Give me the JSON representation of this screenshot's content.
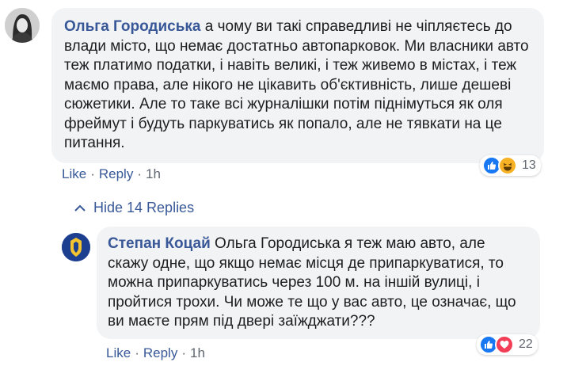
{
  "comment": {
    "author": "Ольга Городиська",
    "text": "а чому ви такі справедливі не чіпляєтесь до влади місто, що немає достатньо автопарковок. Ми власники авто теж платимо податки, і навіть великі, і теж живемо в містах, і теж маємо права, але нікого не цікавить об'єктивність, лише дешеві сюжетики. Але то таке всі журналішки потім піднімуться як оля фреймут і будуть паркуватись як попало, але не тявкати на це питання.",
    "like_label": "Like",
    "reply_label": "Reply",
    "time": "1h",
    "reactions": {
      "icons": [
        "like-icon",
        "haha-icon"
      ],
      "count": "13"
    }
  },
  "hide_replies_label": "Hide 14 Replies",
  "reply": {
    "author": "Степан Коцай",
    "text": "Ольга Городиська я теж маю авто, але скажу одне, що якщо немає місця де припаркуватися, то можна припаркуватись через 100 м. на іншій вулиці, і пройтися трохи. Чи може те що у вас авто, це означає, що ви маєте прям під двері заїжджати???",
    "like_label": "Like",
    "reply_label": "Reply",
    "time": "1h",
    "reactions": {
      "icons": [
        "like-icon",
        "love-icon"
      ],
      "count": "22"
    }
  },
  "colors": {
    "link": "#385898",
    "bubble": "#f2f3f5",
    "like": "#1877f2",
    "haha": "#f7b125",
    "love": "#f33e58"
  }
}
